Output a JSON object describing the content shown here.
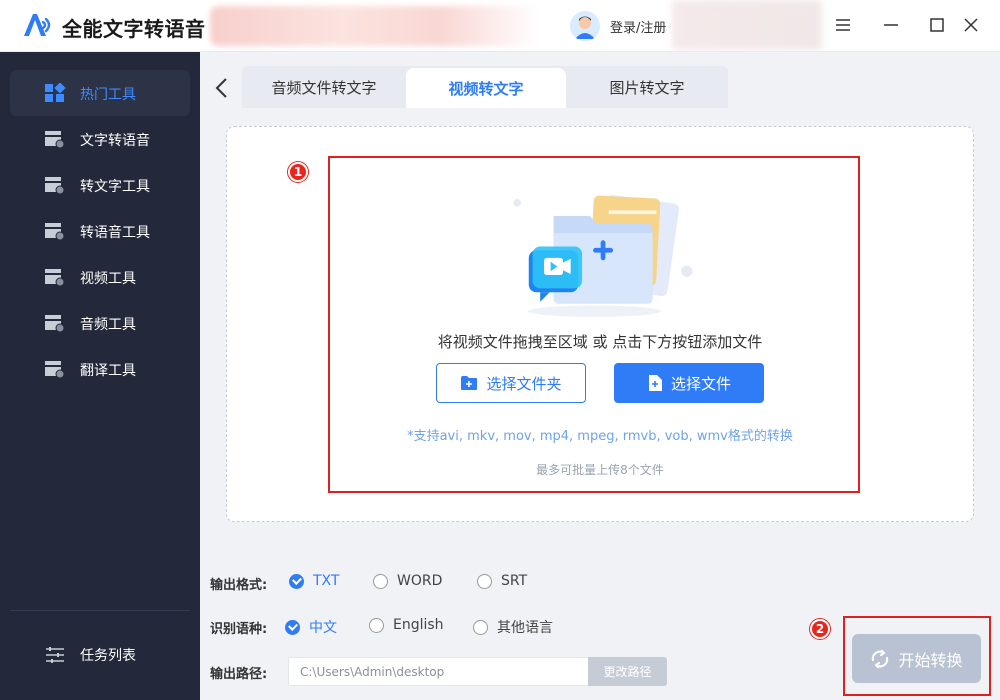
{
  "app": {
    "title": "全能文字转语音",
    "login_label": "登录/注册"
  },
  "sidebar": {
    "items": [
      {
        "label": "热门工具",
        "active": true,
        "icon": "grid-icon"
      },
      {
        "label": "文字转语音",
        "icon": "toolbox-icon"
      },
      {
        "label": "转文字工具",
        "icon": "toolbox-icon"
      },
      {
        "label": "转语音工具",
        "icon": "toolbox-icon"
      },
      {
        "label": "视频工具",
        "icon": "toolbox-icon"
      },
      {
        "label": "音频工具",
        "icon": "toolbox-icon"
      },
      {
        "label": "翻译工具",
        "icon": "toolbox-icon"
      }
    ],
    "task_list_label": "任务列表"
  },
  "tabs": [
    {
      "label": "音频文件转文字"
    },
    {
      "label": "视频转文字",
      "active": true
    },
    {
      "label": "图片转文字"
    }
  ],
  "dropzone": {
    "hint": "将视频文件拖拽至区域 或 点击下方按钮添加文件",
    "select_folder_label": "选择文件夹",
    "select_file_label": "选择文件",
    "formats": "*支持avi, mkv, mov, mp4, mpeg, rmvb, vob, wmv格式的转换",
    "max_files": "最多可批量上传8个文件",
    "badge": "1"
  },
  "options": {
    "output_format_label": "输出格式:",
    "formats": [
      "TXT",
      "WORD",
      "SRT"
    ],
    "format_selected": "TXT",
    "language_label": "识别语种:",
    "languages": [
      "中文",
      "English",
      "其他语言"
    ],
    "language_selected": "中文",
    "path_label": "输出路径:",
    "path_value": "C:\\Users\\Admin\\desktop",
    "change_path_label": "更改路径"
  },
  "start": {
    "label": "开始转换",
    "badge": "2"
  },
  "colors": {
    "accent": "#2f7cf6",
    "sidebar_bg": "#23283a",
    "annotation_red": "#e02020"
  }
}
